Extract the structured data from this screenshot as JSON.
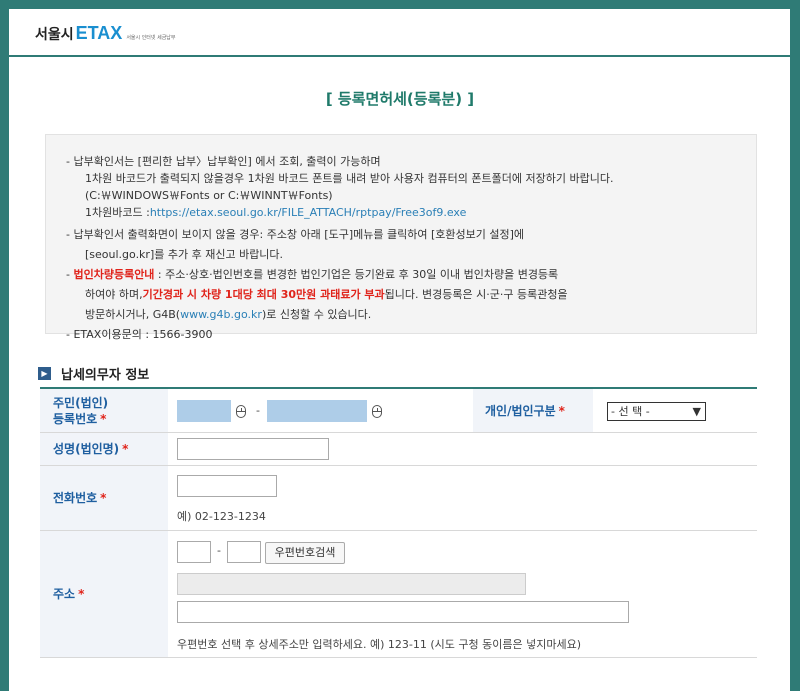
{
  "header": {
    "logo_seoul": "서울시",
    "logo_etax": "ETAX",
    "logo_sub": "서울시 인터넷 세금납부"
  },
  "page_title": "[ 등록면허세(등록분) ]",
  "notice": {
    "l1": "- 납부확인서는 [편리한 납부〉납부확인] 에서 조회, 출력이 가능하며",
    "l2": "1차원 바코드가 출력되지 않을경우 1차원 바코드 폰트를 내려 받아 사용자 컴퓨터의 폰트폴더에 저장하기 바랍니다.",
    "l3": "(C:￦WINDOWS￦Fonts or C:￦WINNT￦Fonts)",
    "l4_pre": "1차원바코드 :",
    "l4_link": "https://etax.seoul.go.kr/FILE_ATTACH/rptpay/Free3of9.exe",
    "l5": "- 납부확인서 출력화면이 보이지 않을 경우: 주소창 아래 [도구]메뉴를 클릭하여 [호환성보기 설정]에",
    "l6": "[seoul.go.kr]를 추가 후 재신고 바랍니다.",
    "l7_pre": "- ",
    "l7_red": "법인차량등록안내",
    "l7_post": " : 주소·상호·법인번호를 변경한 법인기업은 등기완료 후 30일 이내 법인차량을 변경등록",
    "l8_pre": "하여야 하며,",
    "l8_red": "기간경과 시 차량 1대당 최대 30만원 과태료가 부과",
    "l8_post": "됩니다. 변경등록은 시·군·구 등록관청을",
    "l9_pre": "방문하시거나, G4B(",
    "l9_link": "www.g4b.go.kr",
    "l9_post": ")로 신청할 수 있습니다.",
    "l10": "- ETAX이용문의 : 1566-3900"
  },
  "section": {
    "title": "납세의무자 정보",
    "icon": "arrow-square-icon"
  },
  "form": {
    "reg_label_1": "주민(법인)",
    "reg_label_2": "등록번호",
    "required_mark": "*",
    "dash": "-",
    "type_label": "개인/법인구분",
    "type_select": "- 선 택 -",
    "name_label": "성명(법인명)",
    "phone_label": "전화번호",
    "phone_hint": "예) 02-123-1234",
    "address_label": "주소",
    "zip_button": "우편번호검색",
    "address_hint": "우편번호 선택 후 상세주소만 입력하세요. 예) 123-11 (시도 구청 동이름은 넣지마세요)"
  },
  "colors": {
    "frame": "#2f7b76",
    "title": "#1f7a6a",
    "label_text": "#1f5fa0",
    "label_bg": "#f1f4f9",
    "required": "#e0241b",
    "link": "#2a7fb6",
    "masked_input": "#aecde8"
  }
}
